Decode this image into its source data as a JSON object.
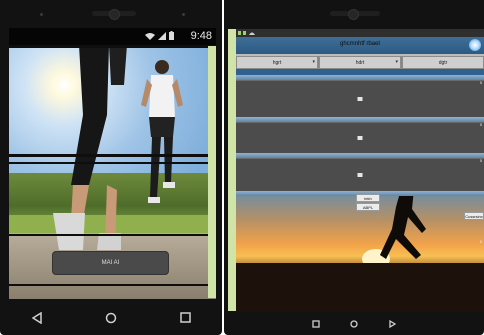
{
  "phone1": {
    "status": {
      "time": "9:48"
    },
    "main_button_label": "MAI AI",
    "nav": {
      "back_icon": "back-triangle-icon",
      "home_icon": "home-circle-icon",
      "recents_icon": "recents-square-icon"
    }
  },
  "phone2": {
    "title": "ghcmnhtf rbaet",
    "tabs": [
      "hgrt",
      "hdrt",
      "dgtr"
    ],
    "panel_tags": [
      "5",
      "5",
      "5",
      "5"
    ],
    "field_labels": [
      "tekh",
      "ABPL",
      "Cussrsinx"
    ],
    "nav": {
      "back_icon": "back-square-icon",
      "home_icon": "home-circle-icon",
      "recents_icon": "recents-triangle-icon"
    }
  },
  "colors": {
    "bezel": "#121212",
    "strip": "#cfe4a6",
    "panel": "#4c4c4c",
    "titlebar": "#2b5b84"
  }
}
